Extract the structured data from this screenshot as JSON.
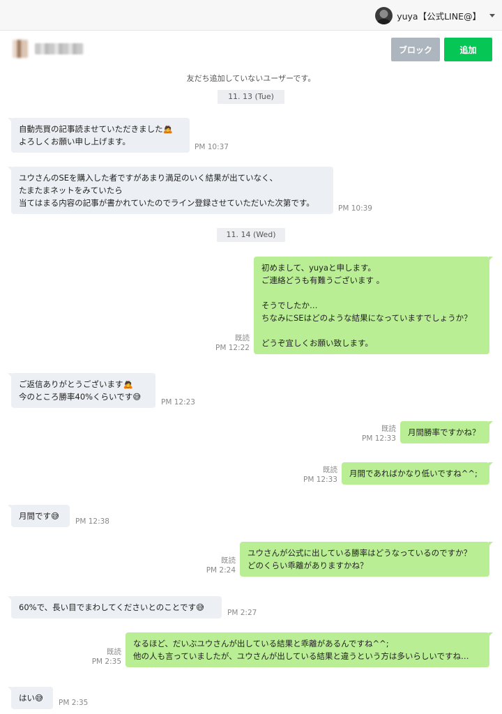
{
  "account": {
    "name": "yuya【公式LINE@】"
  },
  "actions": {
    "block_label": "ブロック",
    "add_label": "追加"
  },
  "notice": "友だち追加していないユーザーです。",
  "dates": [
    "11. 13 (Tue)",
    "11. 14 (Wed)"
  ],
  "messages": [
    {
      "text": "自動売買の記事読ませていただきました🙇\nよろしくお願い申し上げます。",
      "time": "PM 10:37"
    },
    {
      "text": "ユウさんのSEを購入した者ですがあまり満足のいく結果が出ていなく、\nたまたまネットをみていたら\n当てはまる内容の記事が書かれていたのでライン登録させていただいた次第です。",
      "time": "PM 10:39"
    },
    {
      "text": "初めまして、yuyaと申します。\nご連絡どうも有難うございます 。\n\nそうでしたか…\nちなみにSEはどのような結果になっていますでしょうか？\n\nどうぞ宜しくお願い致します。",
      "read": "既読",
      "time": "PM 12:22"
    },
    {
      "text": "ご返信ありがとうございます🙇\n今のところ勝率40%くらいです😅",
      "time": "PM 12:23"
    },
    {
      "text": "月間勝率ですかね？",
      "read": "既読",
      "time": "PM 12:33"
    },
    {
      "text": "月間であればかなり低いですね^^;",
      "read": "既読",
      "time": "PM 12:33"
    },
    {
      "text": "月間です😅",
      "time": "PM 12:38"
    },
    {
      "text": "ユウさんが公式に出している勝率はどうなっているのですか？\nどのくらい乖離がありますかね？",
      "read": "既読",
      "time": "PM 2:24"
    },
    {
      "text": "60%で、長い目でまわしてくださいとのことです😅",
      "time": "PM 2:27"
    },
    {
      "text": "なるほど、だいぶユウさんが出している結果と乖離があるんですね^^;\n他の人も言っていましたが、ユウさんが出している結果と違うという方は多いらしいですね…",
      "read": "既読",
      "time": "PM 2:35"
    },
    {
      "text": "はい😅",
      "time": "PM 2:35"
    }
  ]
}
